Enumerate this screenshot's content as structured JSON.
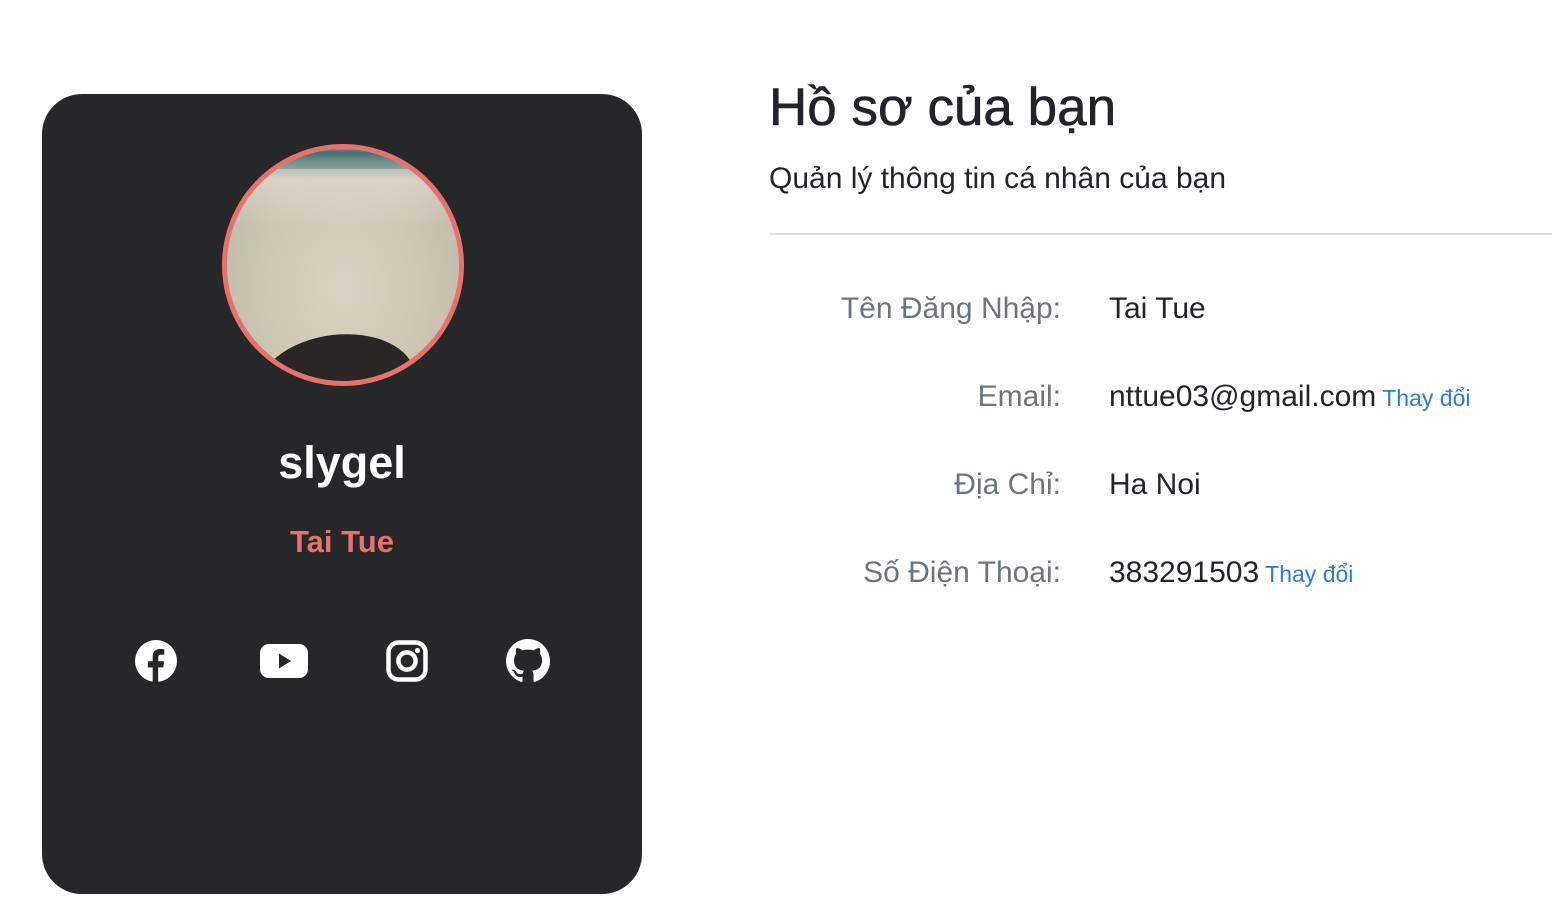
{
  "profile_card": {
    "username": "slygel",
    "full_name": "Tai Tue",
    "accent_color": "#e8716b",
    "card_color": "#262729",
    "social_links": [
      {
        "icon": "facebook-icon"
      },
      {
        "icon": "youtube-icon"
      },
      {
        "icon": "instagram-icon"
      },
      {
        "icon": "github-icon"
      }
    ]
  },
  "main": {
    "title": "Hồ sơ của bạn",
    "subtitle": "Quản lý thông tin cá nhân của bạn",
    "fields": [
      {
        "label": "Tên Đăng Nhập:",
        "value": "Tai Tue",
        "action": ""
      },
      {
        "label": "Email:",
        "value": "nttue03@gmail.com",
        "action": "Thay đổi"
      },
      {
        "label": "Địa Chỉ:",
        "value": "Ha Noi",
        "action": ""
      },
      {
        "label": "Số Điện Thoại:",
        "value": "383291503",
        "action": "Thay đổi"
      }
    ],
    "link_color": "#2a7ed2"
  }
}
